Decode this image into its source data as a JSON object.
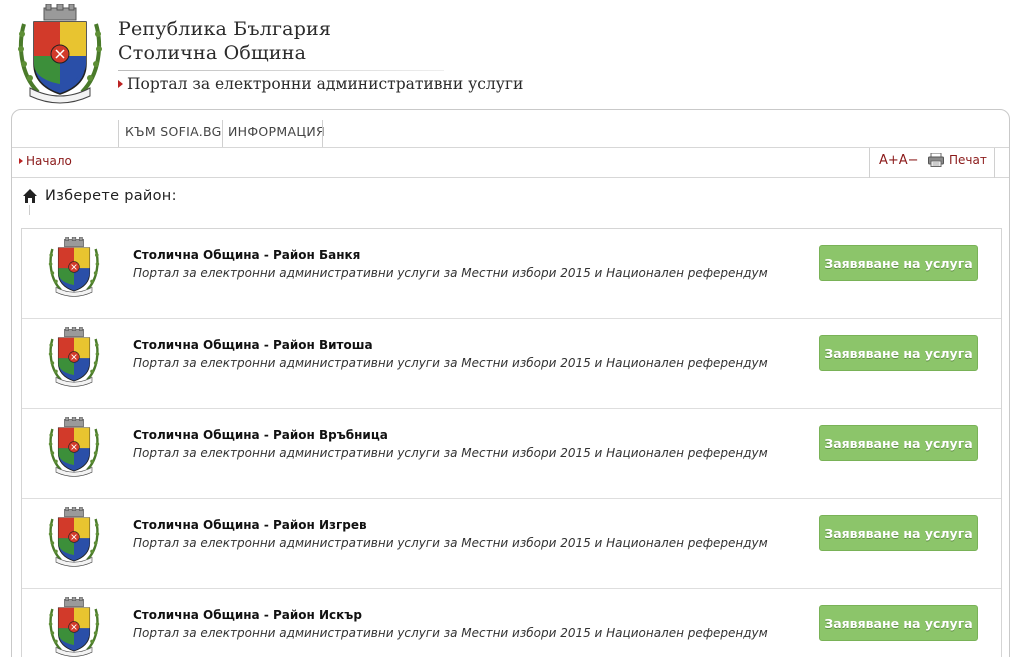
{
  "header": {
    "title_line1": "Република България",
    "title_line2": "Столична Община",
    "portal": "Портал за електронни административни услуги"
  },
  "menu": {
    "items": [
      {
        "label": "КЪМ SOFIA.BG"
      },
      {
        "label": "ИНФОРМАЦИЯ"
      }
    ]
  },
  "toolbar": {
    "breadcrumb": "Начало",
    "font_size": "A+A−",
    "print": "Печат"
  },
  "main": {
    "prompt": "Изберете район:",
    "districts": [
      {
        "title": "Столична Община - Район Банкя",
        "subtitle": "Портал за електронни административни услуги за Местни избори 2015 и Национален референдум",
        "button": "Заявяване на услуга"
      },
      {
        "title": "Столична Община - Район Витоша",
        "subtitle": "Портал за електронни административни услуги за Местни избори 2015 и Национален референдум",
        "button": "Заявяване на услуга"
      },
      {
        "title": "Столична Община - Район Връбница",
        "subtitle": "Портал за електронни административни услуги за Местни избори 2015 и Национален референдум",
        "button": "Заявяване на услуга"
      },
      {
        "title": "Столична Община - Район Изгрев",
        "subtitle": "Портал за електронни административни услуги за Местни избори 2015 и Национален референдум",
        "button": "Заявяване на услуга"
      },
      {
        "title": "Столична Община - Район Искър",
        "subtitle": "Портал за електронни административни услуги за Местни избори 2015 и Национален референдум",
        "button": "Заявяване на услуга"
      }
    ]
  },
  "icons": {
    "coat_of_arms": "sofia-coat-of-arms-icon",
    "home": "home-icon",
    "print": "printer-icon",
    "breadcrumb": "triangle-right-icon"
  },
  "colors": {
    "button": "#8cc56a",
    "link": "#8b1a1a",
    "accent_triangle": "#b22222"
  }
}
